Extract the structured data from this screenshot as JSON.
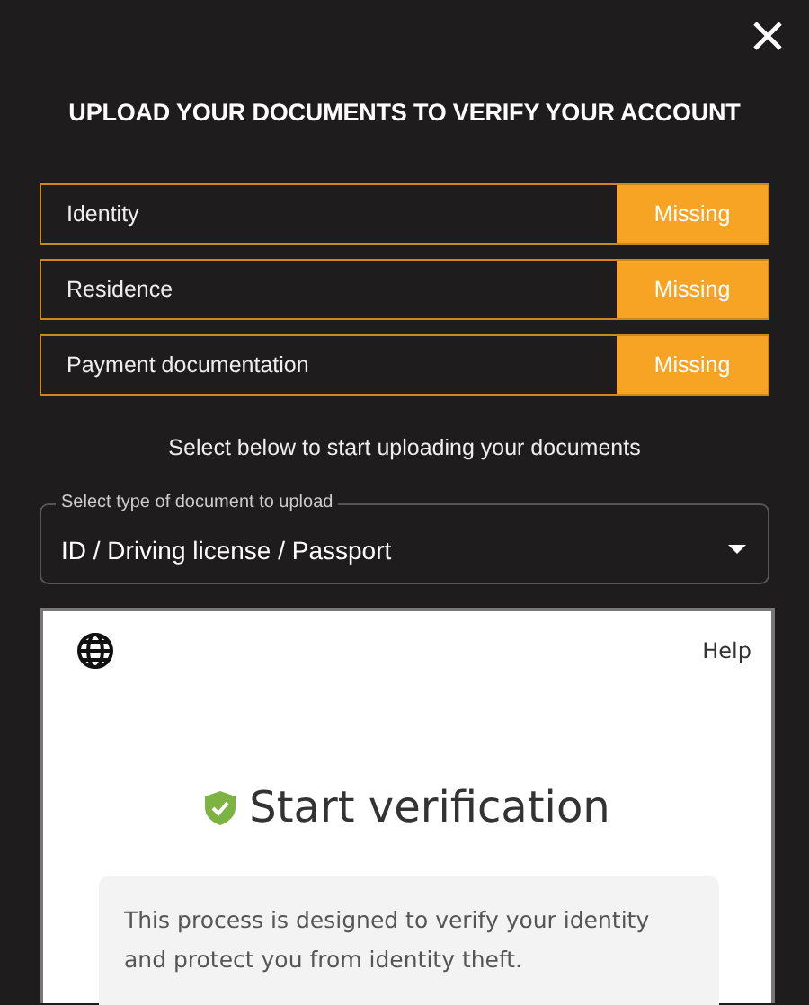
{
  "title": "UPLOAD YOUR DOCUMENTS TO VERIFY YOUR ACCOUNT",
  "documents": [
    {
      "name": "Identity",
      "status": "Missing"
    },
    {
      "name": "Residence",
      "status": "Missing"
    },
    {
      "name": "Payment documentation",
      "status": "Missing"
    }
  ],
  "instruction": "Select below to start uploading your documents",
  "document_type": {
    "label": "Select type of document to upload",
    "value": "ID / Driving license / Passport"
  },
  "verification": {
    "help": "Help",
    "heading": "Start verification",
    "description": "This process is designed to verify your identity and protect you from identity theft."
  }
}
